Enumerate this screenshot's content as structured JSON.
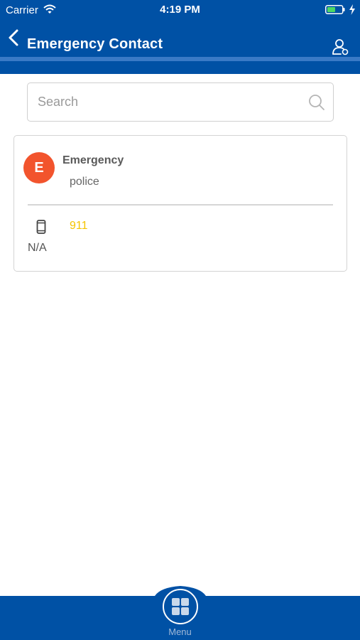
{
  "status_bar": {
    "carrier": "Carrier",
    "time": "4:19 PM"
  },
  "nav": {
    "title": "Emergency Contact",
    "back_icon": "chevron-left-icon",
    "action_icon": "contact-settings-icon"
  },
  "search": {
    "placeholder": "Search",
    "icon": "search-icon"
  },
  "contact": {
    "initial": "E",
    "name": "Emergency",
    "subtitle": "police",
    "phone_icon": "mobile-phone-icon",
    "phone": "911",
    "phone_type": "N/A"
  },
  "tab_bar": {
    "menu_label": "Menu",
    "menu_icon": "grid-icon"
  },
  "colors": {
    "primary": "#0051a5",
    "avatar": "#f2542d",
    "phone_link": "#f5c400"
  }
}
